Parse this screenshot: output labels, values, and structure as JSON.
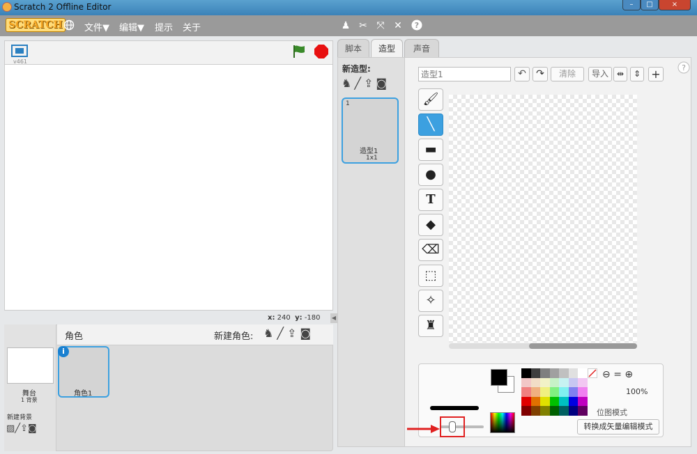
{
  "window": {
    "title": "Scratch 2 Offline Editor",
    "controls": [
      "–",
      "□",
      "×"
    ]
  },
  "menubar": {
    "logo": "SCRATCH",
    "items": [
      {
        "label": "文件▼"
      },
      {
        "label": "编辑▼"
      },
      {
        "label": "提示"
      },
      {
        "label": "关于"
      }
    ]
  },
  "stage": {
    "version": "v461",
    "coords_x_label": "x:",
    "coords_x": "240",
    "coords_y_label": "y:",
    "coords_y": "-180"
  },
  "sprites": {
    "header": "角色",
    "new_sprite_label": "新建角色:",
    "stage_label": "舞台",
    "stage_backdrops": "1 背景",
    "new_backdrop_label": "新建背景",
    "sprite_name": "角色1"
  },
  "tabs": [
    {
      "label": "脚本"
    },
    {
      "label": "造型"
    },
    {
      "label": "声音"
    }
  ],
  "costumes": {
    "new_label": "新造型:",
    "item_index": "1",
    "item_name": "造型1",
    "item_size": "1x1"
  },
  "editor": {
    "costume_name": "造型1",
    "clear_label": "清除",
    "import_label": "导入",
    "zoom": "100%",
    "mode_label": "位图模式",
    "convert_label": "转换成矢量编辑模式"
  },
  "colors": {
    "accent": "#3ca0e0",
    "annotation": "#e02020",
    "palette": [
      "#000000",
      "#3f3f3f",
      "#7f7f7f",
      "#a0a0a0",
      "#c0c0c0",
      "#e0e0e0",
      "#ffffff",
      "#f2c7c7",
      "#f2ddc7",
      "#f2f2c7",
      "#c7f2c7",
      "#c7f2f2",
      "#c7c7f2",
      "#f2c7f2",
      "#f08080",
      "#f0b080",
      "#f0f080",
      "#80f080",
      "#80f0f0",
      "#8080f0",
      "#f080f0",
      "#e00000",
      "#e07000",
      "#e0e000",
      "#00c000",
      "#00c0c0",
      "#0000e0",
      "#c000c0",
      "#800000",
      "#804000",
      "#808000",
      "#006000",
      "#006060",
      "#000080",
      "#600060"
    ]
  }
}
